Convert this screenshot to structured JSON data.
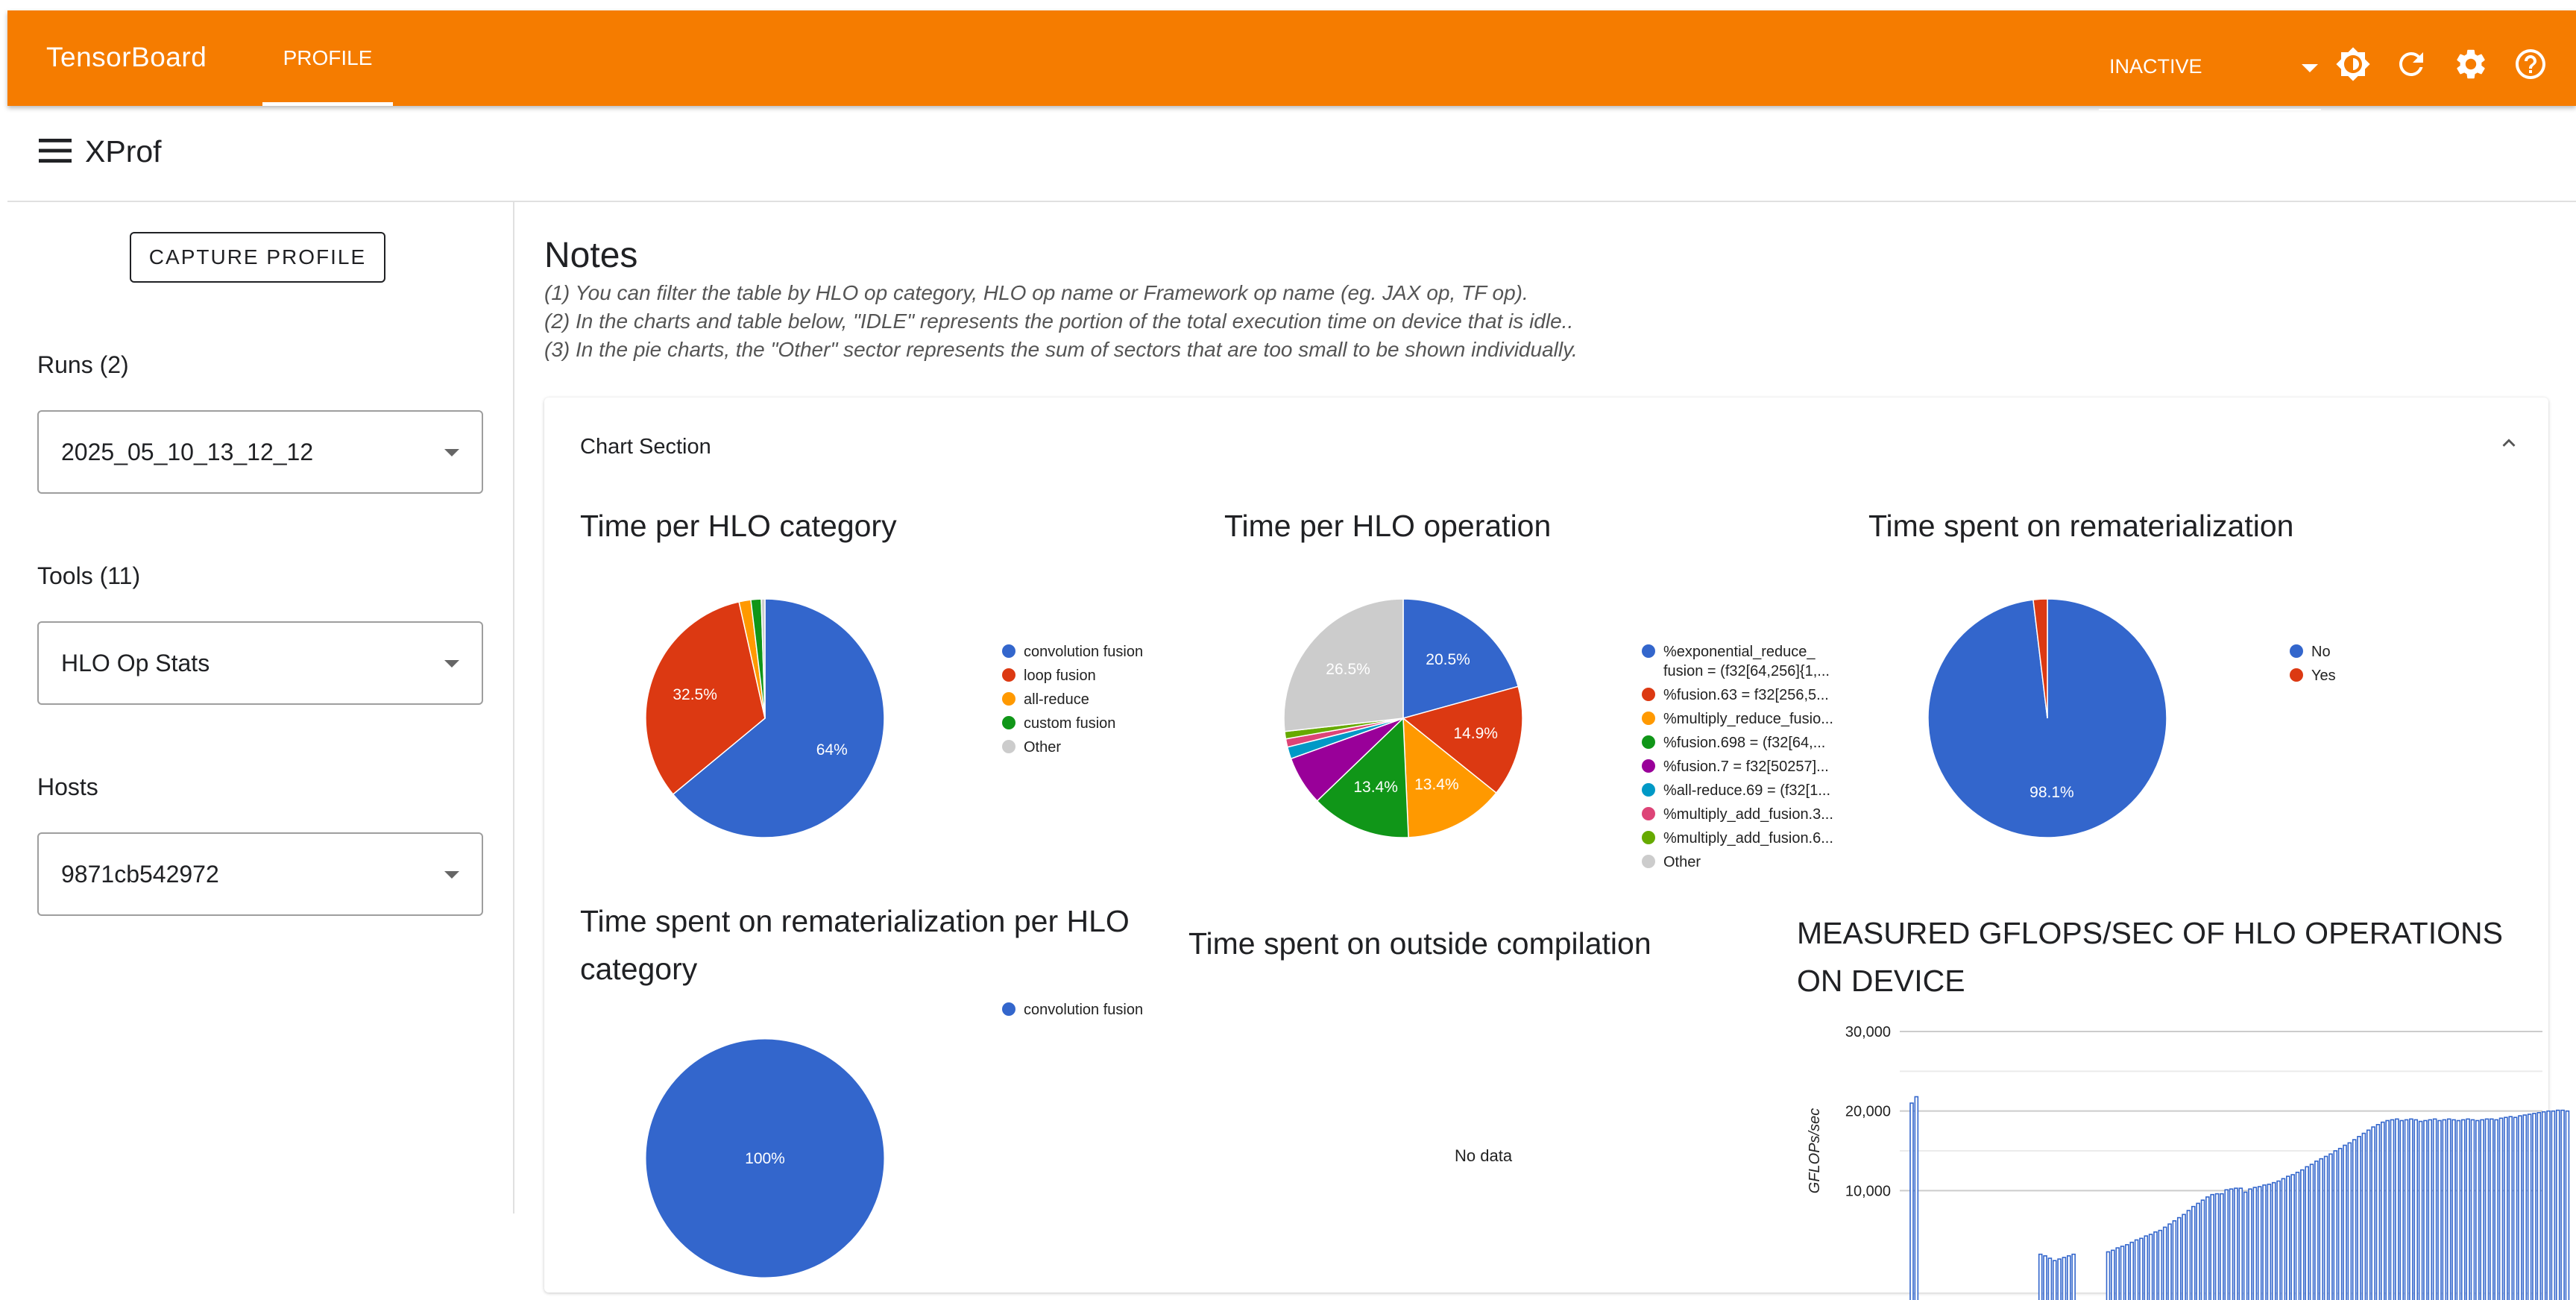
{
  "topbar": {
    "brand": "TensorBoard",
    "tab_profile": "PROFILE",
    "status_select": "INACTIVE",
    "icons": [
      "brightness-icon",
      "refresh-icon",
      "settings-icon",
      "help-icon"
    ],
    "color": "#f57c00"
  },
  "xprof": {
    "title": "XProf"
  },
  "sidebar": {
    "capture_button": "CAPTURE PROFILE",
    "runs_label": "Runs (2)",
    "runs_value": "2025_05_10_13_12_12",
    "tools_label": "Tools (11)",
    "tools_value": "HLO Op Stats",
    "hosts_label": "Hosts",
    "hosts_value": "9871cb542972"
  },
  "notes": {
    "title": "Notes",
    "lines": [
      "(1) You can filter the table by HLO op category, HLO op name or Framework op name (eg. JAX op, TF op).",
      "(2) In the charts and table below, \"IDLE\" represents the portion of the total execution time on device that is idle..",
      "(3) In the pie charts, the \"Other\" sector represents the sum of sectors that are too small to be shown individually."
    ]
  },
  "chart_section": {
    "title": "Chart Section"
  },
  "chart_data": [
    {
      "type": "pie",
      "title": "Time per HLO category",
      "labels": [
        "convolution fusion",
        "loop fusion",
        "all-reduce",
        "custom fusion",
        "Other"
      ],
      "values": [
        64.0,
        32.5,
        1.6,
        1.4,
        0.5
      ],
      "slice_labels": [
        "64%",
        "32.5%",
        "",
        "",
        ""
      ],
      "colors": [
        "#3366cc",
        "#dc3912",
        "#ff9900",
        "#109618",
        "#cccccc"
      ],
      "legend": "right"
    },
    {
      "type": "pie",
      "title": "Time per HLO operation",
      "labels": [
        "%exponential_reduce_ fusion = (f32[64,256]{1,...",
        "%fusion.63 = f32[256,5...",
        "%multiply_reduce_fusio...",
        "%fusion.698 = (f32[64,...",
        "%fusion.7 = f32[50257]...",
        "%all-reduce.69 = (f32[1...",
        "%multiply_add_fusion.3...",
        "%multiply_add_fusion.6...",
        "Other"
      ],
      "values": [
        20.5,
        14.9,
        13.4,
        13.4,
        6.6,
        1.6,
        1.1,
        1.0,
        26.5
      ],
      "slice_labels": [
        "20.5%",
        "14.9%",
        "13.4%",
        "13.4%",
        "",
        "",
        "",
        "",
        "26.5%"
      ],
      "colors": [
        "#3366cc",
        "#dc3912",
        "#ff9900",
        "#109618",
        "#990099",
        "#0099c6",
        "#dd4477",
        "#66aa00",
        "#cccccc"
      ],
      "legend": "right"
    },
    {
      "type": "pie",
      "title": "Time spent on rematerialization",
      "labels": [
        "No",
        "Yes"
      ],
      "values": [
        98.1,
        1.9
      ],
      "slice_labels": [
        "98.1%",
        ""
      ],
      "colors": [
        "#3366cc",
        "#dc3912"
      ],
      "legend": "right"
    },
    {
      "type": "pie",
      "title": "Time spent on rematerialization per HLO category",
      "labels": [
        "convolution fusion"
      ],
      "values": [
        100
      ],
      "slice_labels": [
        "100%"
      ],
      "colors": [
        "#3366cc"
      ],
      "legend": "right"
    },
    {
      "type": "pie",
      "title": "Time spent on outside compilation",
      "labels": [],
      "values": [],
      "empty_message": "No data"
    },
    {
      "type": "bar",
      "title": "MEASURED GFLOPS/SEC OF HLO OPERATIONS ON DEVICE",
      "ylabel": "GFLOPs/sec",
      "yticks": [
        "30,000",
        "20,000",
        "10,000"
      ],
      "ytick_values": [
        30000,
        20000,
        10000
      ],
      "ylim": [
        0,
        30000
      ],
      "color": "#3366cc",
      "values": [
        21000,
        21800,
        2000,
        1800,
        1500,
        1200,
        1400,
        1600,
        1800,
        2000,
        2300,
        2500,
        2800,
        3000,
        3200,
        3500,
        3800,
        4000,
        4300,
        4500,
        4800,
        5000,
        5400,
        5800,
        6200,
        6600,
        7000,
        7500,
        8000,
        8400,
        8800,
        9200,
        9500,
        9600,
        9600,
        10100,
        10200,
        10300,
        10300,
        9800,
        10200,
        10400,
        10500,
        10700,
        10800,
        11000,
        11200,
        11500,
        11800,
        12000,
        12300,
        12600,
        13000,
        13300,
        13700,
        14000,
        14300,
        14600,
        15000,
        15300,
        15700,
        16000,
        16400,
        16800,
        17200,
        17600,
        18000,
        18300,
        18600,
        18800,
        18900,
        19000,
        18800,
        18900,
        19000,
        18900,
        18700,
        18800,
        18900,
        19000,
        18800,
        18900,
        19000,
        18900,
        18800,
        18900,
        19000,
        18900,
        18800,
        18900,
        19000,
        19000,
        18900,
        19100,
        19200,
        19300,
        19200,
        19400,
        19500,
        19600,
        19700,
        19800,
        19900,
        20000,
        20000,
        20100,
        20100,
        20000
      ]
    }
  ]
}
